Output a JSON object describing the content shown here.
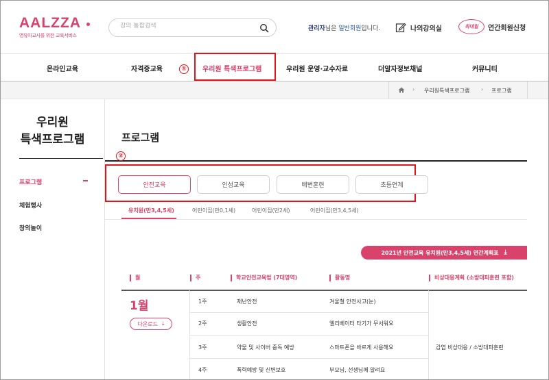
{
  "header": {
    "logo_text": "AALZZA",
    "logo_sub": "영유아교사를 위한 교육서비스",
    "search_placeholder": "강의 통합검색",
    "user_name": "관리자",
    "user_mid": "님은 ",
    "user_grade": "일반회원",
    "user_end": "입니다.",
    "my_class": "나의강의실",
    "badge_text": "최대일",
    "signup": "연간회원신청"
  },
  "nav": {
    "items": [
      "온라인교육",
      "자격증교육",
      "우리원 특색프로그램",
      "우리원 운영·교수자료",
      "더알자정보채널",
      "커뮤니티"
    ],
    "active_index": 2
  },
  "breadcrumb": [
    "우리원특색프로그램",
    "프로그램"
  ],
  "sidebar": {
    "title_line1": "우리원",
    "title_line2": "특색프로그램",
    "items": [
      "프로그램",
      "체험행사",
      "창의놀이"
    ],
    "active_index": 0
  },
  "main": {
    "title": "프로그램",
    "tabs": [
      "안전교육",
      "인성교육",
      "배변훈련",
      "초등연계"
    ],
    "active_tab": 0,
    "subtabs": [
      "유치원(만3,4,5세)",
      "어린이집(만0,1세)",
      "어린이집(만2세)",
      "어린이집(만3,4,5세)"
    ],
    "active_subtab": 0,
    "plan_button": "2021년 안전교육 유치원(만3,4,5세) 연간계획표",
    "download_label": "다운로드"
  },
  "table": {
    "headers": [
      "월",
      "주",
      "학교안전교육법 (7대영역)",
      "활동명",
      "비상대응계획 (소방대피훈련 포함)"
    ],
    "month": "1월",
    "rows": [
      {
        "week": "1주",
        "area": "재난안전",
        "activity": "겨울철 안전사고(눈)"
      },
      {
        "week": "2주",
        "area": "생활안전",
        "activity": "엘리베이터 타기가 무서워요"
      },
      {
        "week": "3주",
        "area": "약물 및 사이버 중독 예방",
        "activity": "스마트폰을 바르게 사용해요"
      },
      {
        "week": "4주",
        "area": "폭력예방 및 신변보호",
        "activity": "부모님, 선생님께 알려요"
      }
    ],
    "emergency": "감염 비상대응 / 소방대피훈련"
  },
  "annotations": [
    "①",
    "②"
  ],
  "colors": {
    "accent": "#d9426b",
    "highlight": "#e3131c"
  }
}
